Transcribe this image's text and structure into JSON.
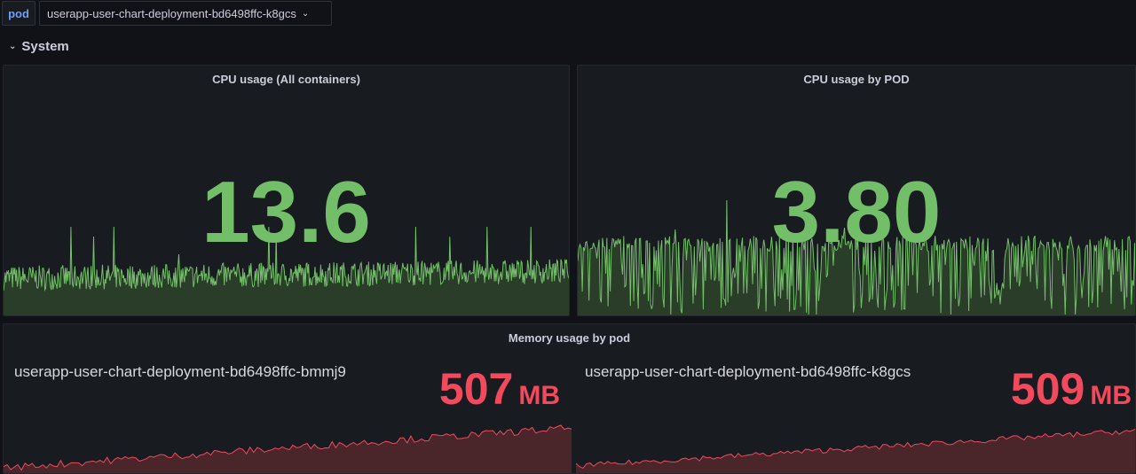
{
  "variables": {
    "pod_label": "pod",
    "pod_value": "userapp-user-chart-deployment-bd6498ffc-k8gcs"
  },
  "row": {
    "title": "System"
  },
  "panels": {
    "cpu_all": {
      "title": "CPU usage (All containers)",
      "value": "13.6"
    },
    "cpu_pod": {
      "title": "CPU usage by POD",
      "value": "3.80"
    },
    "memory": {
      "title": "Memory usage by pod",
      "items": [
        {
          "name": "userapp-user-chart-deployment-bd6498ffc-bmmj9",
          "value": "507",
          "unit": "MB"
        },
        {
          "name": "userapp-user-chart-deployment-bd6498ffc-k8gcs",
          "value": "509",
          "unit": "MB"
        }
      ]
    }
  },
  "colors": {
    "cpu_line": "#73bf69",
    "cpu_fill": "#2a3d29",
    "mem_line": "#f2495c",
    "mem_fill": "#4a262b",
    "pod_label": "#6e9fff"
  },
  "icons": {
    "variable_dropdown": "chevron-down-icon",
    "row_toggle": "chevron-down-icon"
  }
}
